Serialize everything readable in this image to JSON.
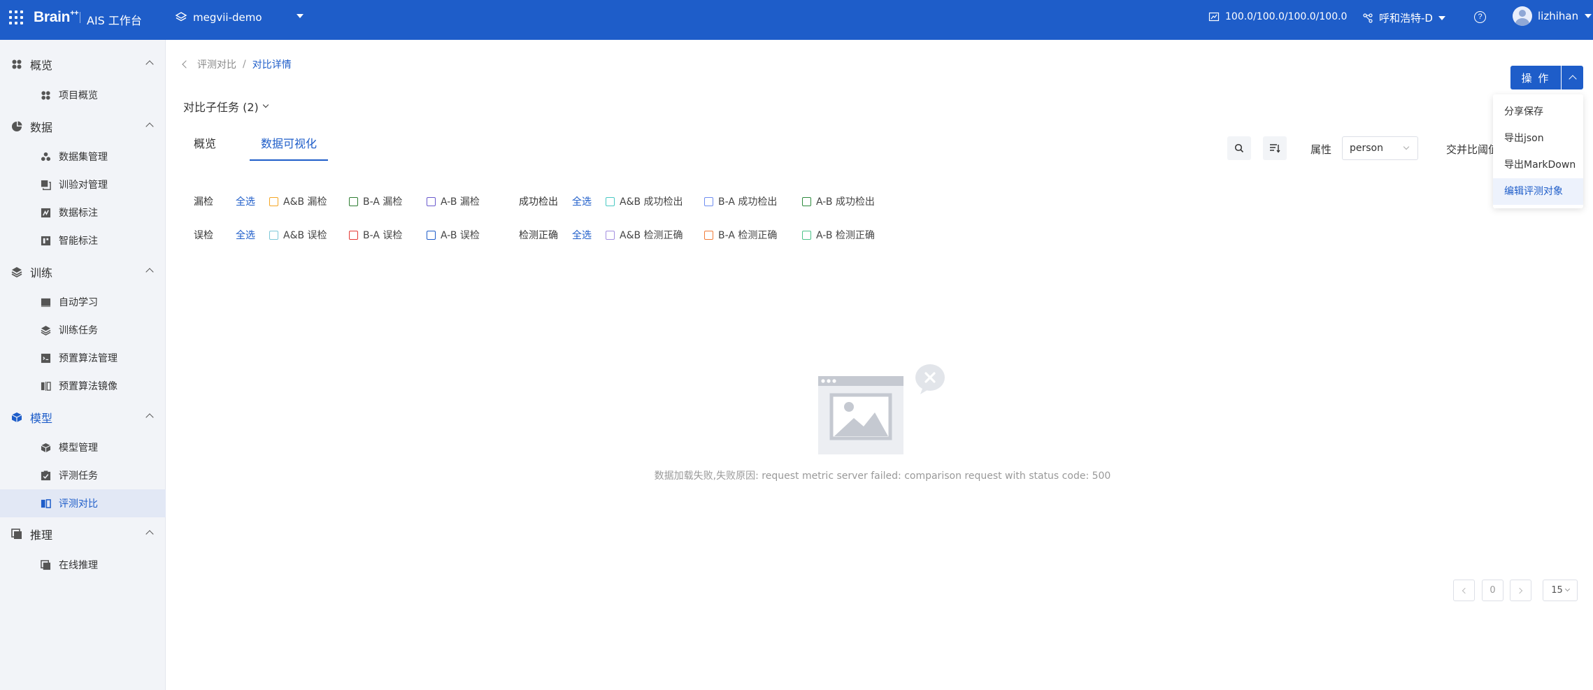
{
  "topbar": {
    "brand": "Brain",
    "brand_sup": "++",
    "workbench": "AIS 工作台",
    "project": "megvii-demo",
    "quota": "100.0/100.0/100.0/100.0",
    "region": "呼和浩特-D",
    "help": "?",
    "username": "lizhihan"
  },
  "sidebar": {
    "overview": {
      "label": "概览",
      "items": [
        "项目概览"
      ]
    },
    "data": {
      "label": "数据",
      "items": [
        "数据集管理",
        "训验对管理",
        "数据标注",
        "智能标注"
      ]
    },
    "train": {
      "label": "训练",
      "items": [
        "自动学习",
        "训练任务",
        "预置算法管理",
        "预置算法镜像"
      ]
    },
    "model": {
      "label": "模型",
      "items": [
        "模型管理",
        "评测任务",
        "评测对比"
      ]
    },
    "inference": {
      "label": "推理",
      "items": [
        "在线推理"
      ]
    }
  },
  "breadcrumb": {
    "parent": "评测对比",
    "sep": "/",
    "current": "对比详情"
  },
  "subtask": "对比子任务 (2)",
  "tabs": [
    "概览",
    "数据可视化"
  ],
  "toolbar": {
    "attr_label": "属性",
    "attr_value": "person",
    "iou_label": "交并比阈值"
  },
  "filters": {
    "select_all": "全选",
    "row1": {
      "a_label": "漏检",
      "a_items": [
        "A&B 漏检",
        "B-A 漏检",
        "A-B 漏检"
      ],
      "b_label": "成功检出",
      "b_items": [
        "A&B 成功检出",
        "B-A 成功检出",
        "A-B 成功检出"
      ]
    },
    "row2": {
      "a_label": "误检",
      "a_items": [
        "A&B 误检",
        "B-A 误检",
        "A-B 误检"
      ],
      "b_label": "检测正确",
      "b_items": [
        "A&B 检测正确",
        "B-A 检测正确",
        "A-B 检测正确"
      ]
    },
    "colors": {
      "row1": [
        "#f5a623",
        "#2e7d32",
        "#6a5acd",
        "#4ac9c4",
        "#6f8ef0",
        "#2e8b3e"
      ],
      "row2": [
        "#7ec8d8",
        "#e53935",
        "#1e5dc9",
        "#a48fe0",
        "#f07c3a",
        "#4cc38a"
      ]
    }
  },
  "action": {
    "button": "操 作",
    "menu": [
      "分享保存",
      "导出json",
      "导出MarkDown",
      "编辑评测对象"
    ],
    "active_index": 3
  },
  "empty": {
    "message": "数据加载失败,失败原因: request metric server failed: comparison request with status code: 500"
  },
  "pagination": {
    "page": "0",
    "page_size": "15"
  },
  "colors": {
    "primary": "#1e5dc9",
    "sidebar_bg": "#f2f4f8"
  }
}
